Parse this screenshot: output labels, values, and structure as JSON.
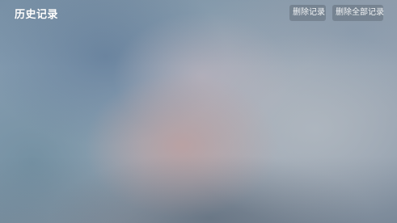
{
  "header": {
    "title": "历史记录",
    "delete_label": "删除记录",
    "delete_all_label": "删除全部记录"
  },
  "colors": {
    "title_text": "#ffffff",
    "button_bg": "rgba(100,112,124,0.55)",
    "button_text": "#f2f4f6"
  }
}
